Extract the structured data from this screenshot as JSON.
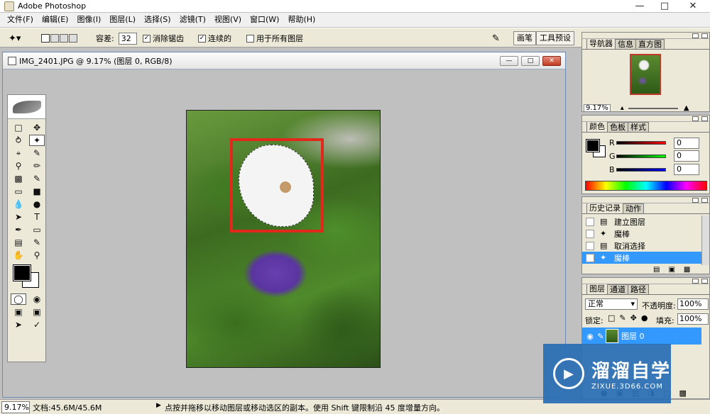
{
  "app": {
    "title": "Adobe Photoshop"
  },
  "menu": [
    "文件(F)",
    "编辑(E)",
    "图像(I)",
    "图层(L)",
    "选择(S)",
    "滤镜(T)",
    "视图(V)",
    "窗口(W)",
    "帮助(H)"
  ],
  "options": {
    "tolerance_label": "容差:",
    "tolerance_value": "32",
    "antialias_label": "消除锯齿",
    "contiguous_label": "连续的",
    "all_layers_label": "用于所有图层",
    "well_tab1": "画笔",
    "well_tab2": "工具预设"
  },
  "document": {
    "title": "IMG_2401.JPG @ 9.17% (图层 0, RGB/8)"
  },
  "status": {
    "zoom": "9.17%",
    "doc_size": "文档:45.6M/45.6M",
    "hint": "点按并拖移以移动图层或移动选区的副本。使用 Shift 键限制沿 45 度增量方向。"
  },
  "navigator": {
    "tabs": [
      "导航器",
      "信息",
      "直方图"
    ],
    "zoom": "9.17%"
  },
  "color_panel": {
    "tabs": [
      "颜色",
      "色板",
      "样式"
    ],
    "channels": [
      {
        "label": "R",
        "value": "0"
      },
      {
        "label": "G",
        "value": "0"
      },
      {
        "label": "B",
        "value": "0"
      }
    ]
  },
  "history_panel": {
    "tabs": [
      "历史记录",
      "动作"
    ],
    "items": [
      {
        "icon": "new-layer-icon",
        "label": "建立图层"
      },
      {
        "icon": "magic-wand-icon",
        "label": "魔棒"
      },
      {
        "icon": "deselect-icon",
        "label": "取消选择"
      },
      {
        "icon": "magic-wand-icon",
        "label": "魔棒"
      }
    ]
  },
  "layers_panel": {
    "tabs": [
      "图层",
      "通道",
      "路径"
    ],
    "blend_mode": "正常",
    "opacity_label": "不透明度:",
    "opacity_value": "100%",
    "lock_label": "锁定:",
    "fill_label": "填充:",
    "fill_value": "100%",
    "layer_name": "图层 0"
  },
  "watermark": {
    "big": "溜溜自学",
    "small": "ZIXUE.3D66.COM"
  },
  "colors": {
    "selection_box": "#e2281a",
    "highlight": "#3399ff",
    "watermark_bg": "#2a6fb5"
  }
}
